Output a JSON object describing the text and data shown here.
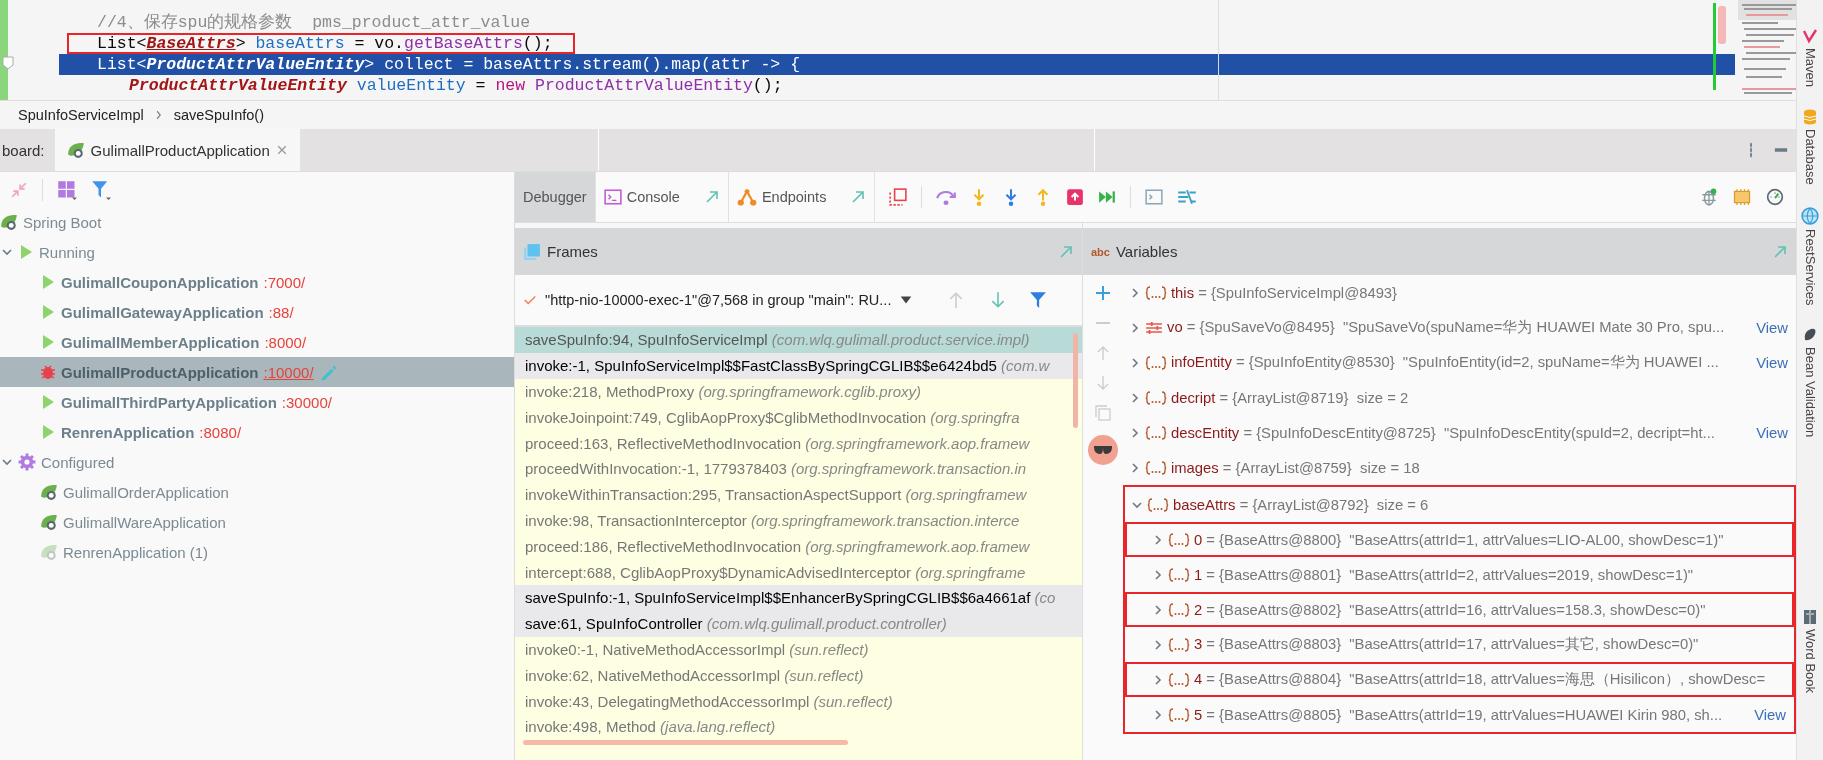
{
  "editor": {
    "lines": [
      {
        "current": false,
        "highlighted": false,
        "indented": false,
        "tokens": [
          {
            "kind": "comment",
            "text": "//4、保存spu的规格参数  pms_product_attr_value"
          }
        ]
      },
      {
        "current": false,
        "highlighted": true,
        "indented": false,
        "tokens": [
          {
            "kind": "plain",
            "text": "List<"
          },
          {
            "kind": "type_underlined",
            "text": "BaseAttrs"
          },
          {
            "kind": "plain",
            "text": "> "
          },
          {
            "kind": "var",
            "text": "baseAttrs"
          },
          {
            "kind": "plain",
            "text": " = vo."
          },
          {
            "kind": "method",
            "text": "getBaseAttrs"
          },
          {
            "kind": "plain",
            "text": "();"
          }
        ]
      },
      {
        "current": true,
        "highlighted": false,
        "indented": false,
        "tokens": [
          {
            "kind": "plain",
            "text": "List<"
          },
          {
            "kind": "type",
            "text": "ProductAttrValueEntity"
          },
          {
            "kind": "plain",
            "text": "> collect = baseAttrs.stream().map(attr -> {"
          }
        ]
      },
      {
        "current": false,
        "highlighted": false,
        "indented": true,
        "tokens": [
          {
            "kind": "type",
            "text": "ProductAttrValueEntity"
          },
          {
            "kind": "var",
            "text": " valueEntity"
          },
          {
            "kind": "plain",
            "text": " = "
          },
          {
            "kind": "keyword",
            "text": "new"
          },
          {
            "kind": "method",
            "text": " ProductAttrValueEntity"
          },
          {
            "kind": "plain",
            "text": "();"
          }
        ]
      }
    ]
  },
  "breadcrumb": [
    "SpuInfoServiceImpl",
    "saveSpuInfo()"
  ],
  "run_dashboard": {
    "title": "board:",
    "tabs": [
      {
        "label": "GulimallProductApplication",
        "selected": true
      }
    ],
    "tree": [
      {
        "label": "Spring Boot",
        "kind": "springboot",
        "children": [
          {
            "label": "Running",
            "kind": "running_group",
            "expanded": true,
            "children": [
              {
                "label": "GulimallCouponApplication",
                "port": ":7000/",
                "kind": "running",
                "selected": false
              },
              {
                "label": "GulimallGatewayApplication",
                "port": ":88/",
                "kind": "running",
                "selected": false
              },
              {
                "label": "GulimallMemberApplication",
                "port": ":8000/",
                "kind": "running",
                "selected": false
              },
              {
                "label": "GulimallProductApplication",
                "port": ":10000/",
                "kind": "debugging",
                "selected": true
              },
              {
                "label": "GulimallThirdPartyApplication",
                "port": ":30000/",
                "kind": "running",
                "selected": false
              },
              {
                "label": "RenrenApplication",
                "port": ":8080/",
                "kind": "running",
                "selected": false
              }
            ]
          },
          {
            "label": "Configured",
            "kind": "configured_group",
            "expanded": true,
            "children": [
              {
                "label": "GulimallOrderApplication",
                "kind": "configured",
                "selected": false
              },
              {
                "label": "GulimallWareApplication",
                "kind": "configured",
                "selected": false
              },
              {
                "label": "RenrenApplication (1)",
                "kind": "disabled",
                "selected": false
              }
            ]
          }
        ]
      }
    ]
  },
  "debugger": {
    "tabs": [
      {
        "label": "Debugger",
        "selected": true
      },
      {
        "label": "Console",
        "selected": false
      },
      {
        "label": "Endpoints",
        "selected": false
      }
    ],
    "frames": {
      "title": "Frames",
      "thread": "\"http-nio-10000-exec-1\"@7,568 in group \"main\": RU...",
      "items": [
        {
          "method": "saveSpuInfo:94, SpuInfoServiceImpl",
          "package": "(com.wlq.gulimall.product.service.impl)",
          "kind": "current"
        },
        {
          "method": "invoke:-1, SpuInfoServiceImpl$$FastClassBySpringCGLIB$$e6424bd5",
          "package": "(com.w",
          "kind": "project"
        },
        {
          "method": "invoke:218, MethodProxy",
          "package": "(org.springframework.cglib.proxy)",
          "kind": "library"
        },
        {
          "method": "invokeJoinpoint:749, CglibAopProxy$CglibMethodInvocation",
          "package": "(org.springfra",
          "kind": "library"
        },
        {
          "method": "proceed:163, ReflectiveMethodInvocation",
          "package": "(org.springframework.aop.framew",
          "kind": "library"
        },
        {
          "method": "proceedWithInvocation:-1, 1779378403",
          "package": "(org.springframework.transaction.in",
          "kind": "library"
        },
        {
          "method": "invokeWithinTransaction:295, TransactionAspectSupport",
          "package": "(org.springframew",
          "kind": "library"
        },
        {
          "method": "invoke:98, TransactionInterceptor",
          "package": "(org.springframework.transaction.interce",
          "kind": "library"
        },
        {
          "method": "proceed:186, ReflectiveMethodInvocation",
          "package": "(org.springframework.aop.framew",
          "kind": "library"
        },
        {
          "method": "intercept:688, CglibAopProxy$DynamicAdvisedInterceptor",
          "package": "(org.springframe",
          "kind": "library"
        },
        {
          "method": "saveSpuInfo:-1, SpuInfoServiceImpl$$EnhancerBySpringCGLIB$$6a4661af",
          "package": "(co",
          "kind": "project"
        },
        {
          "method": "save:61, SpuInfoController",
          "package": "(com.wlq.gulimall.product.controller)",
          "kind": "project"
        },
        {
          "method": "invoke0:-1, NativeMethodAccessorImpl",
          "package": "(sun.reflect)",
          "kind": "library"
        },
        {
          "method": "invoke:62, NativeMethodAccessorImpl",
          "package": "(sun.reflect)",
          "kind": "library"
        },
        {
          "method": "invoke:43, DelegatingMethodAccessorImpl",
          "package": "(sun.reflect)",
          "kind": "library"
        },
        {
          "method": "invoke:498, Method",
          "package": "(java.lang.reflect)",
          "kind": "library"
        }
      ]
    },
    "variables": {
      "title": "Variables",
      "icon_label": "abc",
      "items": [
        {
          "kind": "object",
          "name": "this",
          "type": "= {SpuInfoServiceImpl@8493}",
          "expanded": false,
          "highlighted": false
        },
        {
          "kind": "vo",
          "name": "vo",
          "type": "= {SpuSaveVo@8495}",
          "value": "\"SpuSaveVo(spuName=华为 HUAWEI Mate 30 Pro, spu...",
          "view": "View",
          "expanded": false,
          "highlighted": false
        },
        {
          "kind": "object",
          "name": "infoEntity",
          "type": "= {SpuInfoEntity@8530}",
          "value": "\"SpuInfoEntity(id=2, spuName=华为 HUAWEI ...",
          "view": "View",
          "expanded": false,
          "highlighted": false
        },
        {
          "kind": "object",
          "name": "decript",
          "type": "= {ArrayList@8719}",
          "value": "size = 2",
          "expanded": false,
          "highlighted": false
        },
        {
          "kind": "object",
          "name": "descEntity",
          "type": "= {SpuInfoDescEntity@8725}",
          "value": "\"SpuInfoDescEntity(spuId=2, decript=ht...",
          "view": "View",
          "expanded": false,
          "highlighted": false
        },
        {
          "kind": "object",
          "name": "images",
          "type": "= {ArrayList@8759}",
          "value": "size = 18",
          "expanded": false,
          "highlighted": false
        },
        {
          "kind": "object",
          "name": "baseAttrs",
          "type": "= {ArrayList@8792}",
          "value": "size = 6",
          "expanded": true,
          "highlighted": true,
          "children": [
            {
              "kind": "object",
              "name": "0",
              "type": "= {BaseAttrs@8800}",
              "value": "\"BaseAttrs(attrId=1, attrValues=LIO-AL00, showDesc=1)\"",
              "expanded": false,
              "highlighted": true
            },
            {
              "kind": "object",
              "name": "1",
              "type": "= {BaseAttrs@8801}",
              "value": "\"BaseAttrs(attrId=2, attrValues=2019, showDesc=1)\"",
              "expanded": false,
              "highlighted": false
            },
            {
              "kind": "object",
              "name": "2",
              "type": "= {BaseAttrs@8802}",
              "value": "\"BaseAttrs(attrId=16, attrValues=158.3, showDesc=0)\"",
              "expanded": false,
              "highlighted": true
            },
            {
              "kind": "object",
              "name": "3",
              "type": "= {BaseAttrs@8803}",
              "value": "\"BaseAttrs(attrId=17, attrValues=其它, showDesc=0)\"",
              "expanded": false,
              "highlighted": false
            },
            {
              "kind": "object",
              "name": "4",
              "type": "= {BaseAttrs@8804}",
              "value": "\"BaseAttrs(attrId=18, attrValues=海思（Hisilicon）, showDesc=",
              "expanded": false,
              "highlighted": true
            },
            {
              "kind": "object",
              "name": "5",
              "type": "= {BaseAttrs@8805}",
              "value": "\"BaseAttrs(attrId=19, attrValues=HUAWEI Kirin 980, sh...",
              "view": "View",
              "expanded": false,
              "highlighted": false
            }
          ]
        }
      ]
    }
  },
  "tool_windows": [
    {
      "label": "Maven",
      "kind": "maven"
    },
    {
      "label": "Database",
      "kind": "database"
    },
    {
      "label": "RestServices",
      "kind": "rest"
    },
    {
      "label": "Bean Validation",
      "kind": "bean"
    },
    {
      "label": "Word Book",
      "kind": "book"
    }
  ]
}
